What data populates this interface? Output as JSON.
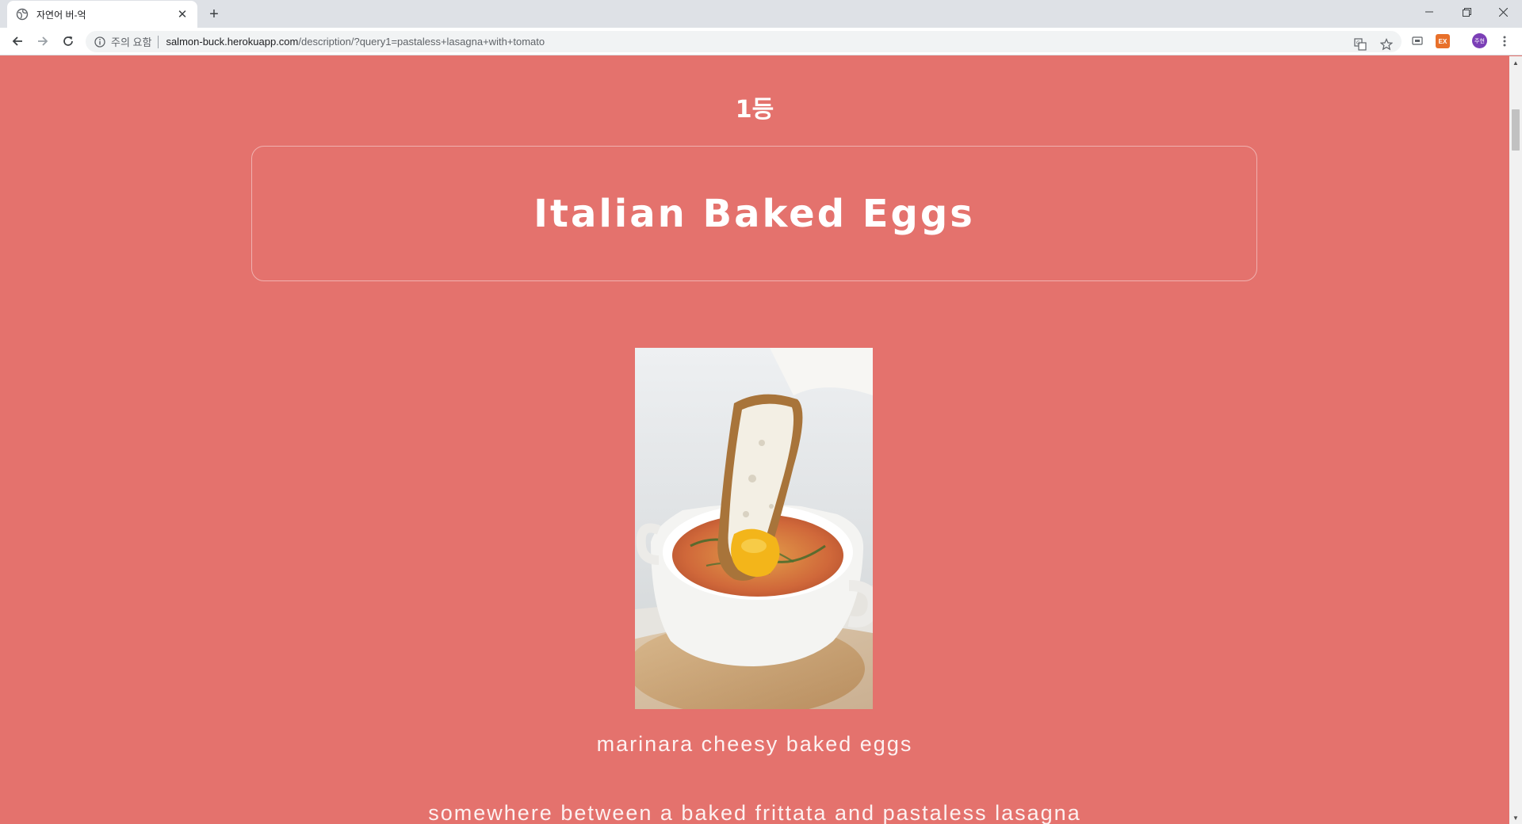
{
  "browser": {
    "tab_title": "자연어 버-억",
    "security_label": "주의 요함",
    "url_host": "salmon-buck.herokuapp.com",
    "url_path": "/description/?query1=pastaless+lasagna+with+tomato",
    "profile_initials": "주현",
    "extension_label": "EX"
  },
  "page": {
    "rank_label": "1등",
    "recipe_title": "Italian Baked Eggs",
    "image_caption": "marinara cheesy baked eggs",
    "description": "somewhere between a baked frittata and pastaless lasagna"
  },
  "colors": {
    "page_background": "#e4726d",
    "text": "#ffffff"
  }
}
